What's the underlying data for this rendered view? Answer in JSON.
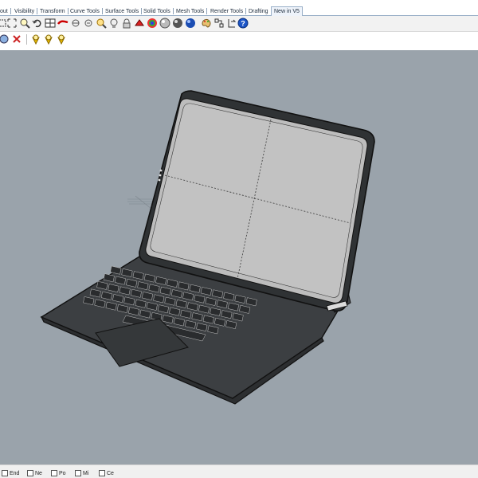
{
  "tabs": [
    {
      "label": "out",
      "active": false
    },
    {
      "label": "Visibility",
      "active": false
    },
    {
      "label": "Transform",
      "active": false
    },
    {
      "label": "Curve Tools",
      "active": false
    },
    {
      "label": "Surface Tools",
      "active": false
    },
    {
      "label": "Solid Tools",
      "active": false
    },
    {
      "label": "Mesh Tools",
      "active": false
    },
    {
      "label": "Render Tools",
      "active": false
    },
    {
      "label": "Drafting",
      "active": false
    },
    {
      "label": "New in V5",
      "active": true
    }
  ],
  "toolbar1_icons": [
    "zoom-extents-icon",
    "zoom-window-icon",
    "zoom-icon",
    "undo-view-icon",
    "four-viewports-icon",
    "pan-icon",
    "rotate-view-icon",
    "zoom-out-icon",
    "zoom-selected-icon",
    "lightbulb-icon",
    "lock-icon",
    "red-object-icon",
    "color-wheel-icon",
    "shaded-sphere-icon",
    "rendered-sphere-icon",
    "blue-sphere-icon",
    "paint-palette-icon",
    "snap-icon",
    "help-icon"
  ],
  "toolbar2_icons": [
    "select-icon",
    "delete-icon",
    "lightbulb-on-icon",
    "lightbulb-off-icon",
    "lightbulb-toggle-icon"
  ],
  "colors": {
    "viewport_bg": "#9aa3ab",
    "model_body": "#3a3d40",
    "model_screen": "#b9b9b9",
    "model_edges": "#111111",
    "keys": "#2a2c2e"
  },
  "statusbar": {
    "osnaps": [
      {
        "label": "End",
        "checked": false
      },
      {
        "label": "Ne",
        "checked": false
      },
      {
        "label": "Po",
        "checked": false
      },
      {
        "label": "Mi",
        "checked": false
      },
      {
        "label": "Ce",
        "checked": false
      }
    ]
  }
}
